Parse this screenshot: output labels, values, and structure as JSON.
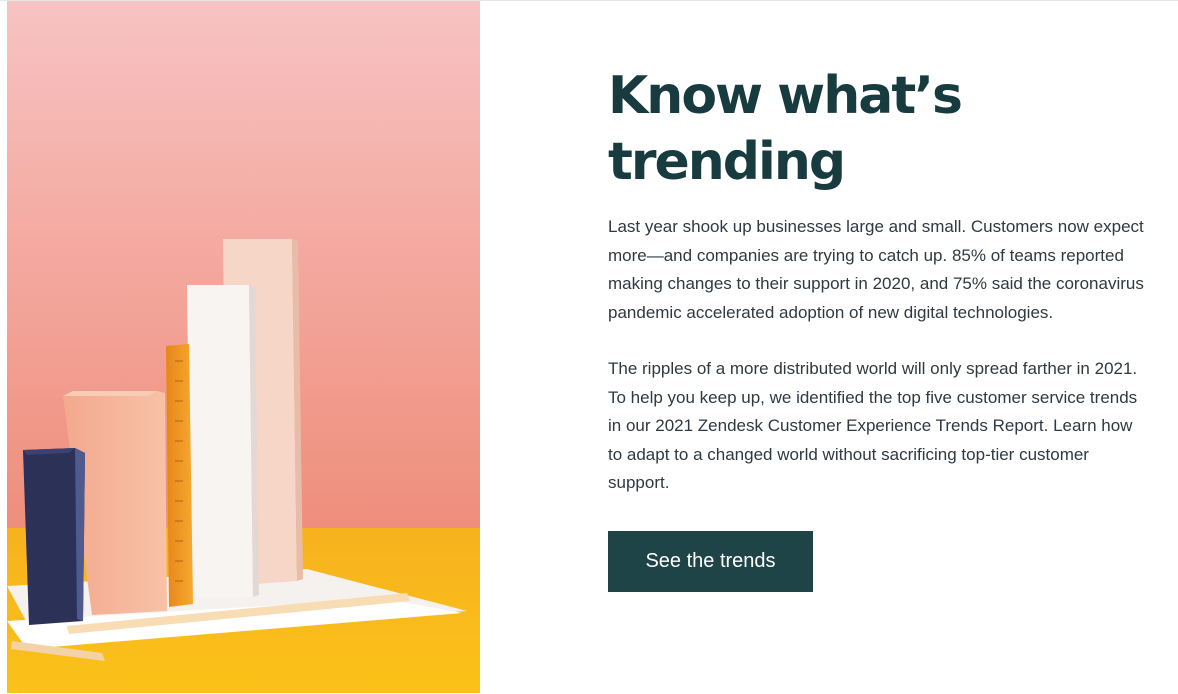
{
  "hero": {
    "image_alt_icon": "blocks-bar-chart-photo",
    "headline": "Know what’s trending",
    "paragraph_1": "Last year shook up businesses large and small. Customers now expect more—and companies are trying to catch up. 85% of teams reported making changes to their support in 2020, and 75% said the coronavirus pandemic accelerated adoption of new digital technologies.",
    "paragraph_2": "The ripples of a more distributed world will only spread farther in 2021. To help you keep up, we identified the top five customer service trends in our 2021 Zendesk Customer Experience Trends Report. Learn how to adapt to a changed world without sacrificing top-tier customer support.",
    "cta_label": "See the trends"
  },
  "colors": {
    "headline": "#173b3f",
    "body_text": "#2f3941",
    "cta_background": "#1f4448",
    "photo_wall": "#f2a89a",
    "photo_table": "#f6b619"
  }
}
